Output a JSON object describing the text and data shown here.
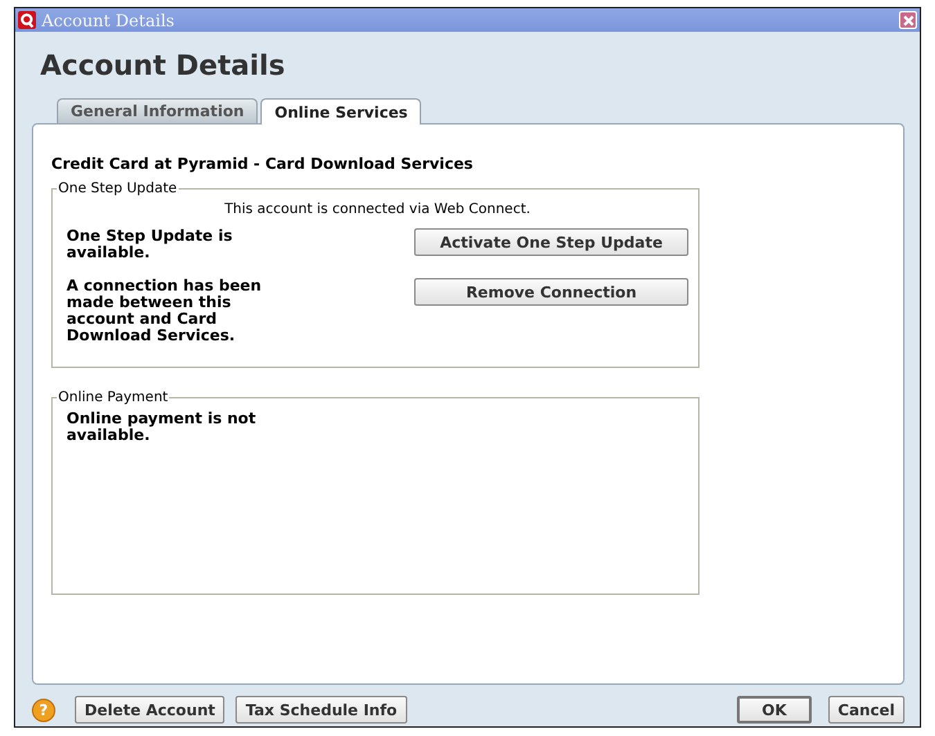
{
  "window": {
    "title": "Account Details"
  },
  "heading": "Account Details",
  "tabs": [
    {
      "label": "General Information",
      "selected": false
    },
    {
      "label": "Online Services",
      "selected": true
    }
  ],
  "panel": {
    "title": "Credit Card at Pyramid - Card Download Services",
    "groups": [
      {
        "legend": "One Step Update",
        "note": "This account is connected via Web Connect.",
        "rows": [
          {
            "text": "One Step Update is available.",
            "button": "Activate One Step Update"
          },
          {
            "text": "A connection has been made between this account and Card Download Services.",
            "button": "Remove Connection"
          }
        ]
      },
      {
        "legend": "Online Payment",
        "rows": [
          {
            "text": "Online payment is not available."
          }
        ]
      }
    ]
  },
  "footer": {
    "help": "?",
    "left_buttons": [
      "Delete Account",
      "Tax Schedule Info"
    ],
    "right_buttons": [
      {
        "label": "OK",
        "default": true
      },
      {
        "label": "Cancel",
        "default": false
      }
    ]
  }
}
